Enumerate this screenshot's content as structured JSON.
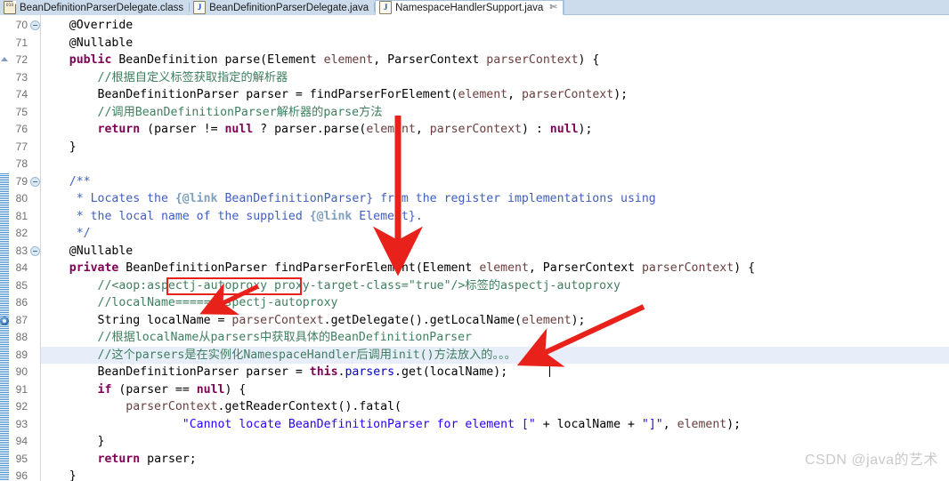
{
  "window": {
    "app": "Eclipse IDE Java Editor",
    "watermark": "CSDN @java的艺术"
  },
  "tabbar": {
    "tabs": [
      {
        "label": "BeanDefinitionParserDelegate.class",
        "icon": "class-file-icon",
        "active": false,
        "closeable": false
      },
      {
        "label": "BeanDefinitionParserDelegate.java",
        "icon": "java-file-icon",
        "active": false,
        "closeable": false
      },
      {
        "label": "NamespaceHandlerSupport.java",
        "icon": "java-file-icon",
        "active": true,
        "closeable": true,
        "close_glyph": "✄"
      }
    ]
  },
  "editor": {
    "first_line_number": 70,
    "highlighted_line": 89,
    "caret_line": 89,
    "fold_lines": [
      70,
      79,
      83
    ],
    "breakpoint_marker_line": 87,
    "changed_block_start_line": 79,
    "changed_block_end_line": 97,
    "lines": [
      {
        "n": 70,
        "text": "    @Override"
      },
      {
        "n": 71,
        "text": "    @Nullable"
      },
      {
        "n": 72,
        "text": "    public BeanDefinition parse(Element element, ParserContext parserContext) {"
      },
      {
        "n": 73,
        "text": "        //根据自定义标签获取指定的解析器"
      },
      {
        "n": 74,
        "text": "        BeanDefinitionParser parser = findParserForElement(element, parserContext);"
      },
      {
        "n": 75,
        "text": "        //调用BeanDefinitionParser解析器的parse方法"
      },
      {
        "n": 76,
        "text": "        return (parser != null ? parser.parse(element, parserContext) : null);"
      },
      {
        "n": 77,
        "text": "    }"
      },
      {
        "n": 78,
        "text": ""
      },
      {
        "n": 79,
        "text": "    /**"
      },
      {
        "n": 80,
        "text": "     * Locates the {@link BeanDefinitionParser} from the register implementations using"
      },
      {
        "n": 81,
        "text": "     * the local name of the supplied {@link Element}."
      },
      {
        "n": 82,
        "text": "     */"
      },
      {
        "n": 83,
        "text": "    @Nullable"
      },
      {
        "n": 84,
        "text": "    private BeanDefinitionParser findParserForElement(Element element, ParserContext parserContext) {"
      },
      {
        "n": 85,
        "text": "        //<aop:aspectj-autoproxy proxy-target-class=\"true\"/>标签的aspectj-autoproxy"
      },
      {
        "n": 86,
        "text": "        //localName======aspectj-autoproxy"
      },
      {
        "n": 87,
        "text": "        String localName = parserContext.getDelegate().getLocalName(element);"
      },
      {
        "n": 88,
        "text": "        //根据localName从parsers中获取具体的BeanDefinitionParser"
      },
      {
        "n": 89,
        "text": "        //这个parsers是在实例化NamespaceHandler后调用init()方法放入的。。。"
      },
      {
        "n": 90,
        "text": "        BeanDefinitionParser parser = this.parsers.get(localName);"
      },
      {
        "n": 91,
        "text": "        if (parser == null) {"
      },
      {
        "n": 92,
        "text": "            parserContext.getReaderContext().fatal("
      },
      {
        "n": 93,
        "text": "                    \"Cannot locate BeanDefinitionParser for element [\" + localName + \"]\", element);"
      },
      {
        "n": 94,
        "text": "        }"
      },
      {
        "n": 95,
        "text": "        return parser;"
      },
      {
        "n": 96,
        "text": "    }"
      }
    ]
  },
  "annotations": {
    "color": "#e8221a",
    "highlight_box": {
      "label": "aspectj-autoproxy",
      "target_line": 85
    },
    "arrows": [
      {
        "name": "arrow-to-findParserForElement",
        "from_line": 76,
        "to_line": 84
      },
      {
        "name": "arrow-to-localName-declaration",
        "from_line": 86,
        "to_line": 87
      },
      {
        "name": "arrow-to-parsers-get-localName",
        "from_line": 89,
        "to_line": 90
      }
    ]
  }
}
